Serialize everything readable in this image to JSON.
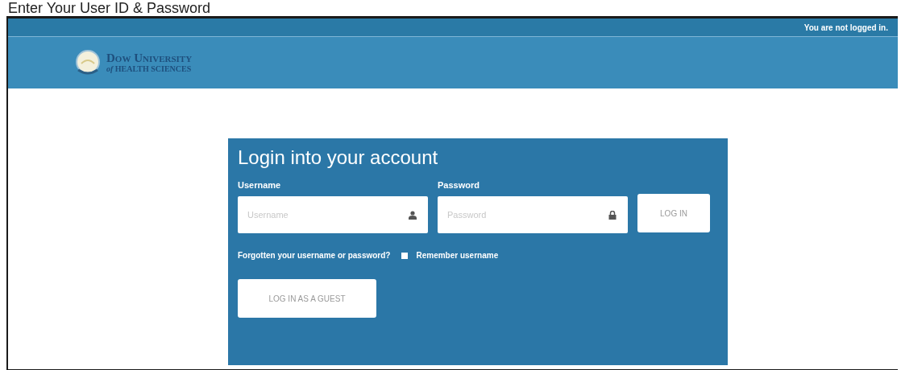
{
  "caption": "Enter Your User ID & Password",
  "top_bar": {
    "status": "You are not logged in."
  },
  "logo": {
    "line1": "Dow University",
    "line2": "*of* HEALTH SCIENCES"
  },
  "login": {
    "title": "Login into your account",
    "fields": [
      {
        "label": "Username",
        "placeholder": "Username",
        "kind": "user"
      },
      {
        "label": "Password",
        "placeholder": "Password",
        "kind": "password"
      }
    ],
    "login_button": "LOG IN",
    "forgot_link": "Forgotten your username or password?",
    "remember": {
      "label": "Remember username",
      "checked": false
    },
    "guest_button": "LOG IN AS A GUEST"
  }
}
